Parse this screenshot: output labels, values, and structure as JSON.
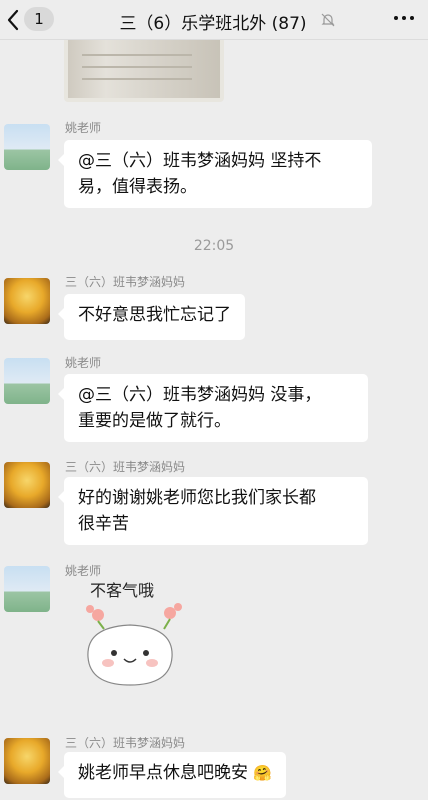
{
  "header": {
    "unread_count": "1",
    "title": "三（6）乐学班北外 (87)"
  },
  "messages": {
    "m1": {
      "sender": "姚老师",
      "text": "@三（六）班韦梦涵妈妈 坚持不易，值得表扬。",
      "line1": "@三（六）班韦梦涵妈妈 坚持不",
      "line2": "易，值得表扬。"
    },
    "time": "22:05",
    "m2": {
      "sender": "三（六）班韦梦涵妈妈",
      "text": "不好意思我忙忘记了"
    },
    "m3": {
      "sender": "姚老师",
      "line1": "@三（六）班韦梦涵妈妈 没事，",
      "line2": "重要的是做了就行。"
    },
    "m4": {
      "sender": "三（六）班韦梦涵妈妈",
      "line1": "好的谢谢姚老师您比我们家长都",
      "line2": "很辛苦"
    },
    "m5": {
      "sender": "姚老师",
      "sticker_text": "不客气哦"
    },
    "m6": {
      "sender": "三（六）班韦梦涵妈妈",
      "text": "姚老师早点休息吧晚安",
      "emoji": "🤗"
    }
  },
  "colors": {
    "background": "#ededed",
    "bubble": "#ffffff",
    "meta_text": "#8a8a8a"
  }
}
